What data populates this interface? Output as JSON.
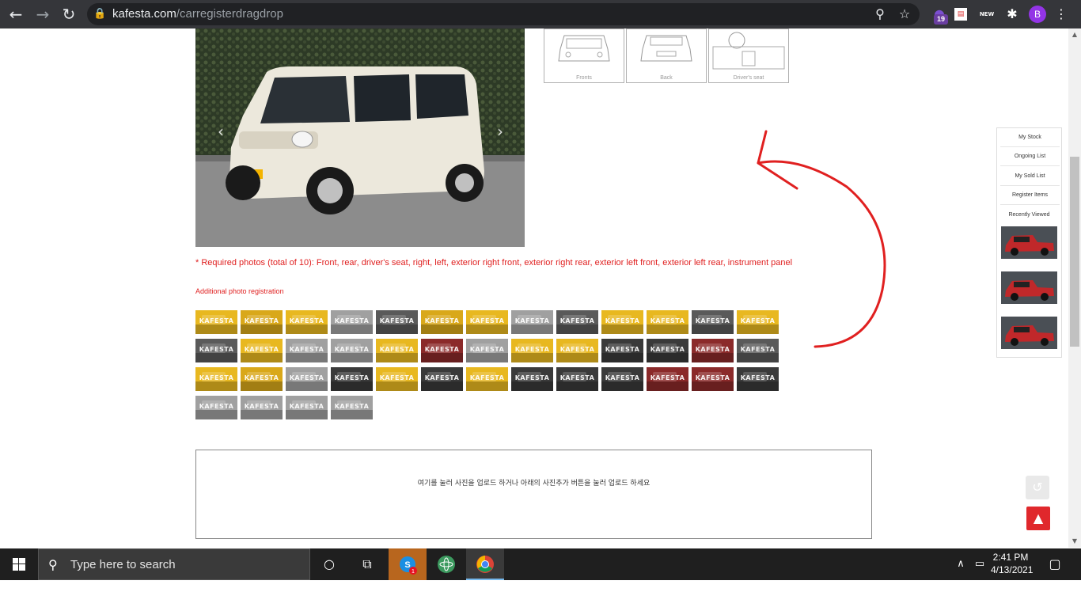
{
  "browser": {
    "url_host": "kafesta.com",
    "url_path": "/carregisterdragdrop",
    "extension_badge": "19",
    "ext_new_label": "NEW",
    "profile_initial": "B"
  },
  "photo_diagrams": [
    {
      "label": "Fronts"
    },
    {
      "label": "Back"
    },
    {
      "label": "Driver's seat"
    }
  ],
  "gallery": {
    "required_note": "* Required photos (total of 10): Front, rear, driver's seat, right, left, exterior right front, exterior right rear, exterior left front, exterior left rear, instrument panel",
    "additional_label": "Additional photo registration",
    "watermark": "KAFESTA"
  },
  "upload": {
    "instruction": "여기를 눌러 사진을 업로드 하거나 아래의 사진추가 버튼을 눌러 업로드 하세요"
  },
  "sidebar": {
    "items": [
      "My Stock",
      "Ongoing List",
      "My Sold List",
      "Register Items"
    ],
    "recent_label": "Recently Viewed"
  },
  "taskbar": {
    "search_placeholder": "Type here to search",
    "time": "2:41 PM",
    "date": "4/13/2021",
    "notification_count": "1"
  },
  "colors": {
    "accent_red": "#e02020",
    "top_button": "#e0282c",
    "chrome_bar": "#35363a"
  }
}
